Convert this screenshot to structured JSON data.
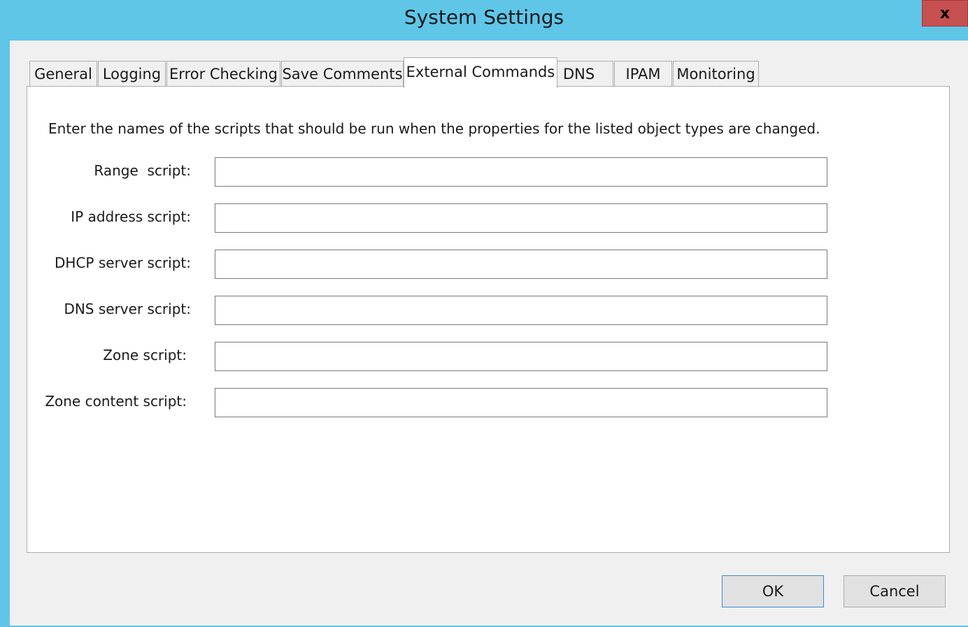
{
  "window": {
    "title": "System Settings",
    "close_label": "x"
  },
  "tabs": [
    {
      "label": "General"
    },
    {
      "label": "Logging"
    },
    {
      "label": "Error Checking"
    },
    {
      "label": "Save Comments"
    },
    {
      "label": "External Commands",
      "selected": true
    },
    {
      "label": "DNS"
    },
    {
      "label": "IPAM"
    },
    {
      "label": "Monitoring"
    }
  ],
  "panel": {
    "description": "Enter the names of the scripts that should be run when the properties for the listed object types are changed.",
    "fields": [
      {
        "label": "Range  script:",
        "value": ""
      },
      {
        "label": "IP address script:",
        "value": ""
      },
      {
        "label": "DHCP server script:",
        "value": ""
      },
      {
        "label": "DNS server script:",
        "value": ""
      },
      {
        "label": "Zone script:",
        "value": ""
      },
      {
        "label": "Zone content script:",
        "value": ""
      }
    ]
  },
  "buttons": {
    "ok_label": "OK",
    "cancel_label": "Cancel"
  },
  "colors": {
    "title_bar": "#5fc6e8",
    "close_button": "#c75050",
    "dialog_background": "#f0f0f0",
    "default_button_border": "#3c8ad7"
  }
}
